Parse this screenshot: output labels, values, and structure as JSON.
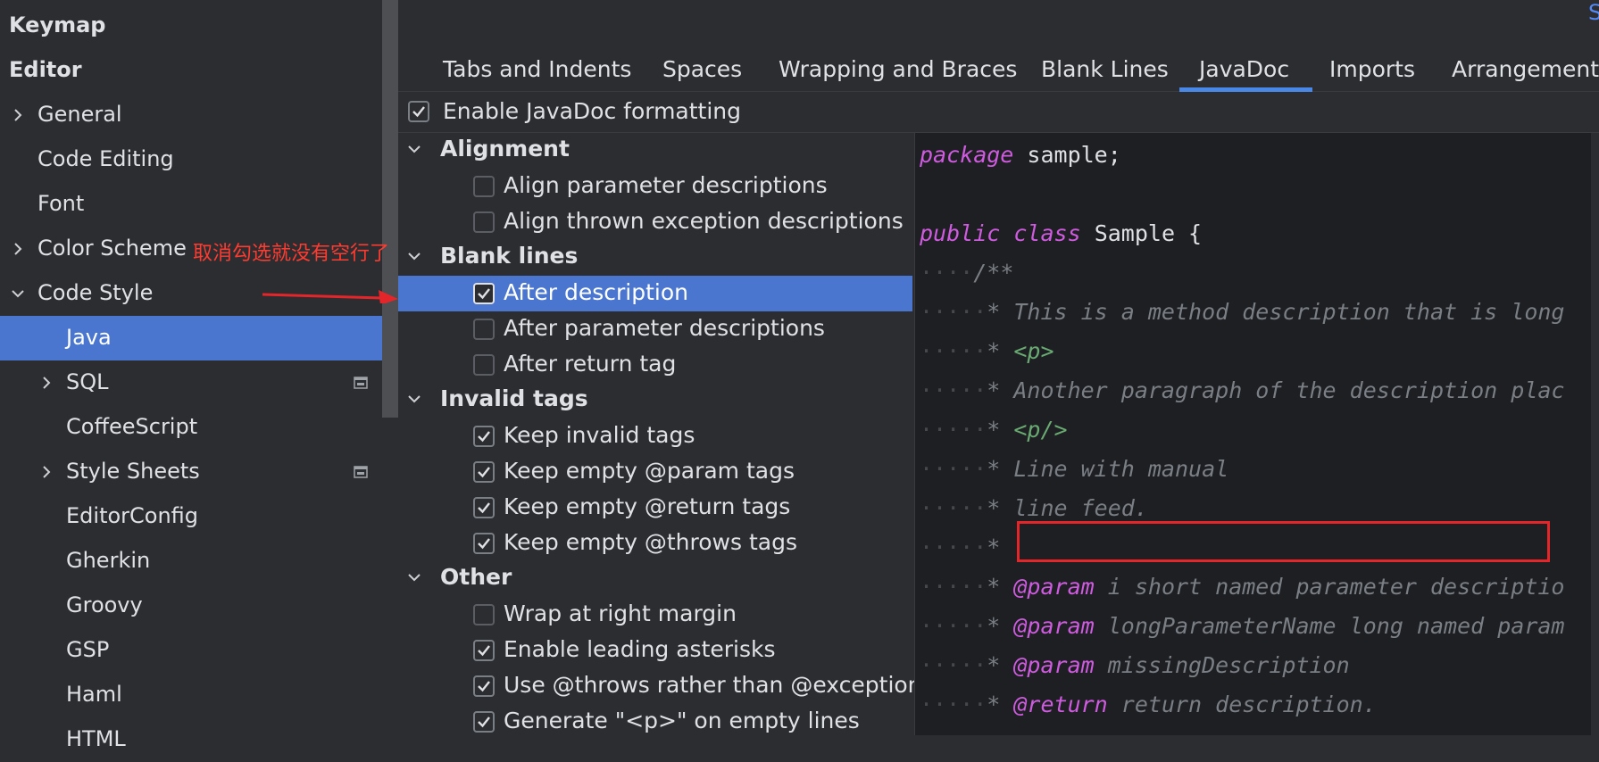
{
  "sidebar": {
    "items": [
      {
        "label": "Keymap",
        "bold": true,
        "indent": 0,
        "chevron": ""
      },
      {
        "label": "Editor",
        "bold": true,
        "indent": 0,
        "chevron": ""
      },
      {
        "label": "General",
        "bold": false,
        "indent": 1,
        "chevron": "right"
      },
      {
        "label": "Code Editing",
        "bold": false,
        "indent": 1,
        "chevron": ""
      },
      {
        "label": "Font",
        "bold": false,
        "indent": 1,
        "chevron": ""
      },
      {
        "label": "Color Scheme",
        "bold": false,
        "indent": 1,
        "chevron": "right"
      },
      {
        "label": "Code Style",
        "bold": false,
        "indent": 1,
        "chevron": "down"
      },
      {
        "label": "Java",
        "bold": false,
        "indent": 2,
        "chevron": "",
        "selected": true
      },
      {
        "label": "SQL",
        "bold": false,
        "indent": 2,
        "chevron": "right",
        "badge": true
      },
      {
        "label": "CoffeeScript",
        "bold": false,
        "indent": 2,
        "chevron": ""
      },
      {
        "label": "Style Sheets",
        "bold": false,
        "indent": 2,
        "chevron": "right",
        "badge": true
      },
      {
        "label": "EditorConfig",
        "bold": false,
        "indent": 2,
        "chevron": ""
      },
      {
        "label": "Gherkin",
        "bold": false,
        "indent": 2,
        "chevron": ""
      },
      {
        "label": "Groovy",
        "bold": false,
        "indent": 2,
        "chevron": ""
      },
      {
        "label": "GSP",
        "bold": false,
        "indent": 2,
        "chevron": ""
      },
      {
        "label": "Haml",
        "bold": false,
        "indent": 2,
        "chevron": ""
      },
      {
        "label": "HTML",
        "bold": false,
        "indent": 2,
        "chevron": ""
      }
    ]
  },
  "annotation": {
    "text": "取消勾选就没有空行了",
    "color": "#ff3b30"
  },
  "top_link": "S",
  "tabs": [
    {
      "label": "Tabs and Indents",
      "active": false
    },
    {
      "label": "Spaces",
      "active": false
    },
    {
      "label": "Wrapping and Braces",
      "active": false
    },
    {
      "label": "Blank Lines",
      "active": false
    },
    {
      "label": "JavaDoc",
      "active": true
    },
    {
      "label": "Imports",
      "active": false
    },
    {
      "label": "Arrangement",
      "active": false
    }
  ],
  "enable_javadoc": {
    "label": "Enable JavaDoc formatting",
    "checked": true
  },
  "options": [
    {
      "type": "group",
      "label": "Alignment"
    },
    {
      "type": "check",
      "label": "Align parameter descriptions",
      "checked": false
    },
    {
      "type": "check",
      "label": "Align thrown exception descriptions",
      "checked": false
    },
    {
      "type": "group",
      "label": "Blank lines"
    },
    {
      "type": "check",
      "label": "After description",
      "checked": true,
      "selected": true
    },
    {
      "type": "check",
      "label": "After parameter descriptions",
      "checked": false
    },
    {
      "type": "check",
      "label": "After return tag",
      "checked": false
    },
    {
      "type": "group",
      "label": "Invalid tags"
    },
    {
      "type": "check",
      "label": "Keep invalid tags",
      "checked": true
    },
    {
      "type": "check",
      "label": "Keep empty @param tags",
      "checked": true
    },
    {
      "type": "check",
      "label": "Keep empty @return tags",
      "checked": true
    },
    {
      "type": "check",
      "label": "Keep empty @throws tags",
      "checked": true
    },
    {
      "type": "group",
      "label": "Other"
    },
    {
      "type": "check",
      "label": "Wrap at right margin",
      "checked": false
    },
    {
      "type": "check",
      "label": "Enable leading asterisks",
      "checked": true
    },
    {
      "type": "check",
      "label": "Use @throws rather than @exception",
      "checked": true
    },
    {
      "type": "check",
      "label": "Generate \"<p>\" on empty lines",
      "checked": true
    }
  ],
  "preview": {
    "lines": [
      [
        {
          "c": "kw",
          "t": "package"
        },
        {
          "c": "plain",
          "t": " sample;"
        }
      ],
      [],
      [
        {
          "c": "kw",
          "t": "public"
        },
        {
          "c": "plain",
          "t": " "
        },
        {
          "c": "kw",
          "t": "class"
        },
        {
          "c": "plain",
          "t": " Sample {"
        }
      ],
      [
        {
          "c": "dots",
          "t": "····"
        },
        {
          "c": "cm",
          "t": "/**"
        }
      ],
      [
        {
          "c": "dots",
          "t": "·····"
        },
        {
          "c": "cm",
          "t": "* This is a method description that is long"
        }
      ],
      [
        {
          "c": "dots",
          "t": "·····"
        },
        {
          "c": "cm",
          "t": "* "
        },
        {
          "c": "tag",
          "t": "<p>"
        }
      ],
      [
        {
          "c": "dots",
          "t": "·····"
        },
        {
          "c": "cm",
          "t": "* Another paragraph of the description plac"
        }
      ],
      [
        {
          "c": "dots",
          "t": "·····"
        },
        {
          "c": "cm",
          "t": "* "
        },
        {
          "c": "tag",
          "t": "<p/>"
        }
      ],
      [
        {
          "c": "dots",
          "t": "·····"
        },
        {
          "c": "cm",
          "t": "* Line with manual"
        }
      ],
      [
        {
          "c": "dots",
          "t": "·····"
        },
        {
          "c": "cm",
          "t": "* line feed."
        }
      ],
      [
        {
          "c": "dots",
          "t": "·····"
        },
        {
          "c": "cm",
          "t": "*"
        }
      ],
      [
        {
          "c": "dots",
          "t": "·····"
        },
        {
          "c": "cm",
          "t": "* "
        },
        {
          "c": "jtag",
          "t": "@param"
        },
        {
          "c": "cm",
          "t": " i short named parameter descriptio"
        }
      ],
      [
        {
          "c": "dots",
          "t": "·····"
        },
        {
          "c": "cm",
          "t": "* "
        },
        {
          "c": "jtag",
          "t": "@param"
        },
        {
          "c": "cm",
          "t": " longParameterName long named param"
        }
      ],
      [
        {
          "c": "dots",
          "t": "·····"
        },
        {
          "c": "cm",
          "t": "* "
        },
        {
          "c": "jtag",
          "t": "@param"
        },
        {
          "c": "cm",
          "t": " missingDescription"
        }
      ],
      [
        {
          "c": "dots",
          "t": "·····"
        },
        {
          "c": "cm",
          "t": "* "
        },
        {
          "c": "jtag",
          "t": "@return"
        },
        {
          "c": "cm",
          "t": " return description."
        }
      ]
    ]
  }
}
